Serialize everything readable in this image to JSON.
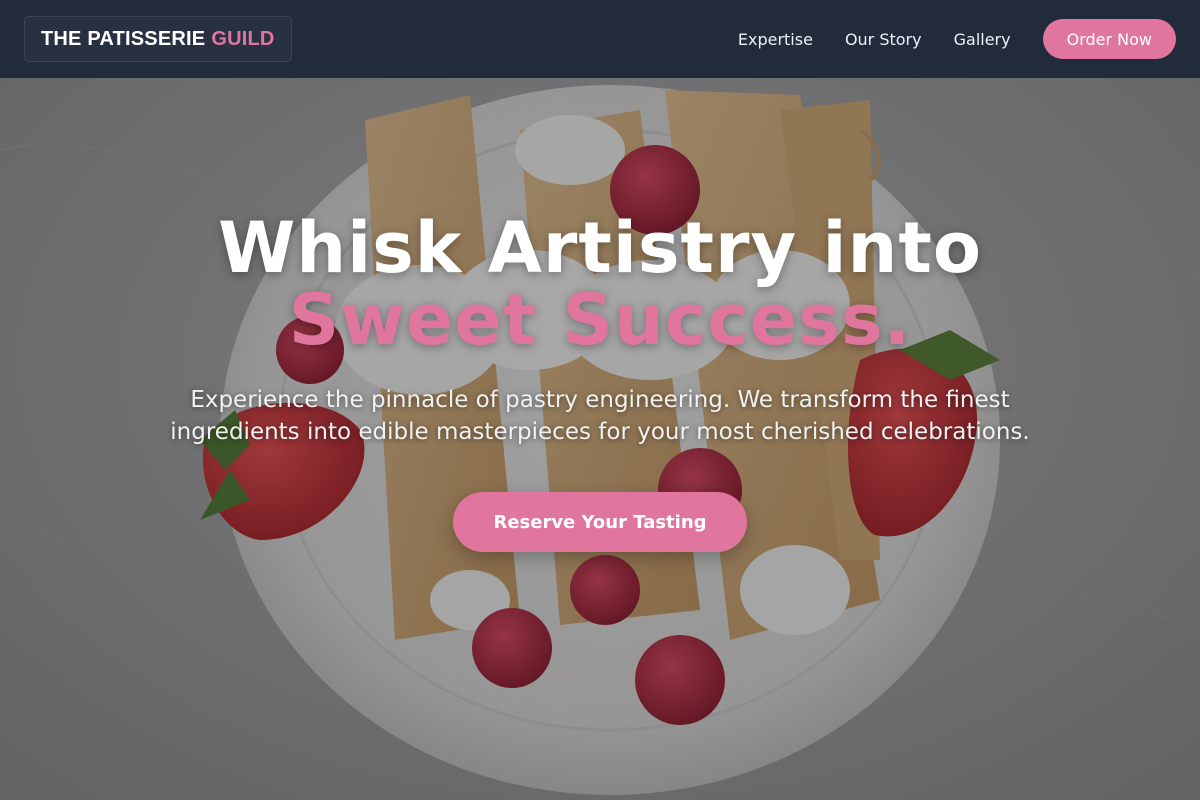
{
  "brand": {
    "name": "THE PATISSERIE",
    "accent": "GUILD",
    "accent_color": "#e0769d"
  },
  "nav": {
    "links": [
      {
        "label": "Expertise"
      },
      {
        "label": "Our Story"
      },
      {
        "label": "Gallery"
      }
    ],
    "cta_label": "Order Now"
  },
  "hero": {
    "headline_line1": "Whisk Artistry into",
    "headline_line2": "Sweet Success.",
    "subtext": "Experience the pinnacle of pastry engineering. We transform the finest ingredients into edible masterpieces for your most cherished celebrations.",
    "cta_label": "Reserve Your Tasting",
    "background_image": "plate-of-crepes-with-strawberries-and-raspberries-on-marble"
  },
  "colors": {
    "accent": "#e0769d",
    "navbar": "#1f293b",
    "text": "#ffffff"
  }
}
